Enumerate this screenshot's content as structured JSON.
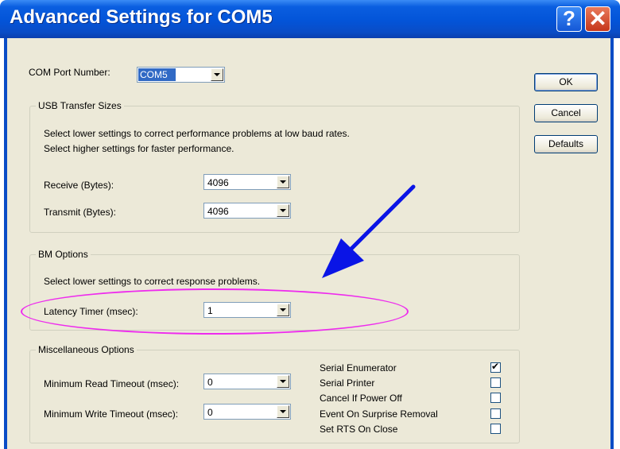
{
  "window": {
    "title": "Advanced Settings for COM5",
    "help": "?",
    "close": "✕"
  },
  "com_port": {
    "label": "COM Port Number:",
    "value": "COM5"
  },
  "buttons": {
    "ok": "OK",
    "cancel": "Cancel",
    "defaults": "Defaults"
  },
  "usb": {
    "legend": "USB Transfer Sizes",
    "line1": "Select lower settings to correct performance problems at low baud rates.",
    "line2": "Select higher settings for faster performance.",
    "receive_label": "Receive (Bytes):",
    "receive_value": "4096",
    "transmit_label": "Transmit (Bytes):",
    "transmit_value": "4096"
  },
  "bm": {
    "legend": "BM Options",
    "line1": "Select lower settings to correct response problems.",
    "latency_label": "Latency Timer (msec):",
    "latency_value": "1"
  },
  "misc": {
    "legend": "Miscellaneous Options",
    "min_read_label": "Minimum Read Timeout (msec):",
    "min_read_value": "0",
    "min_write_label": "Minimum Write Timeout (msec):",
    "min_write_value": "0",
    "options": [
      {
        "label": "Serial Enumerator",
        "checked": true
      },
      {
        "label": "Serial Printer",
        "checked": false
      },
      {
        "label": "Cancel If Power Off",
        "checked": false
      },
      {
        "label": "Event On Surprise Removal",
        "checked": false
      },
      {
        "label": "Set RTS On Close",
        "checked": false
      }
    ]
  },
  "annotation": {
    "arrow_color": "#0a14e6",
    "ellipse_color": "#ee2bee"
  }
}
